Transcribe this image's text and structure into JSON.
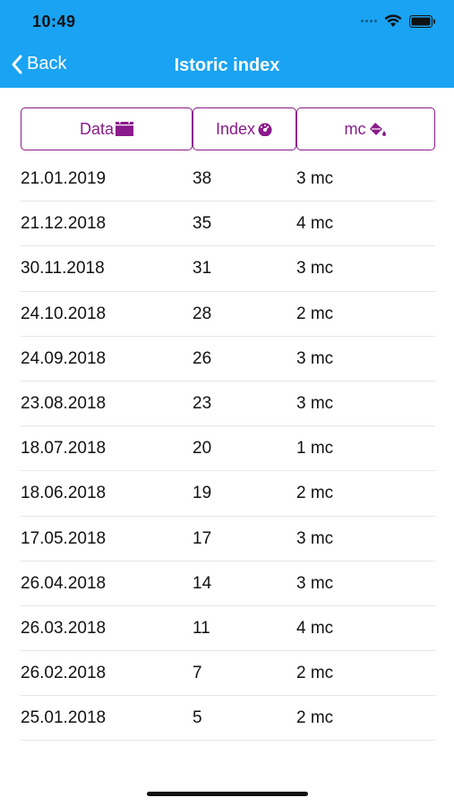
{
  "status": {
    "time": "10:49"
  },
  "nav": {
    "back_label": "Back",
    "title": "Istoric index"
  },
  "table": {
    "headers": [
      "Data",
      "Index",
      "mc"
    ],
    "header_icons": [
      "calendar-icon",
      "gauge-icon",
      "paint-bucket-icon"
    ],
    "rows": [
      {
        "date": "21.01.2019",
        "index": "38",
        "mc": "3 mc"
      },
      {
        "date": "21.12.2018",
        "index": "35",
        "mc": "4 mc"
      },
      {
        "date": "30.11.2018",
        "index": "31",
        "mc": "3 mc"
      },
      {
        "date": "24.10.2018",
        "index": "28",
        "mc": "2 mc"
      },
      {
        "date": "24.09.2018",
        "index": "26",
        "mc": "3 mc"
      },
      {
        "date": "23.08.2018",
        "index": "23",
        "mc": "3 mc"
      },
      {
        "date": "18.07.2018",
        "index": "20",
        "mc": "1 mc"
      },
      {
        "date": "18.06.2018",
        "index": "19",
        "mc": "2 mc"
      },
      {
        "date": "17.05.2018",
        "index": "17",
        "mc": "3 mc"
      },
      {
        "date": "26.04.2018",
        "index": "14",
        "mc": "3 mc"
      },
      {
        "date": "26.03.2018",
        "index": "11",
        "mc": "4 mc"
      },
      {
        "date": "26.02.2018",
        "index": "7",
        "mc": "2 mc"
      },
      {
        "date": "25.01.2018",
        "index": "5",
        "mc": "2 mc"
      }
    ]
  },
  "colors": {
    "nav_bar": "#1aa3f2",
    "accent": "#8a1a8c"
  }
}
